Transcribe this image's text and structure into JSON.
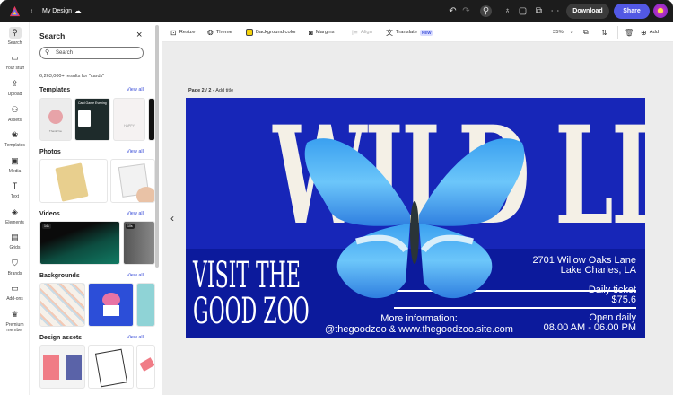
{
  "topbar": {
    "title": "My Design",
    "download": "Download",
    "share": "Share"
  },
  "rail": [
    {
      "label": "Search",
      "icon": "search"
    },
    {
      "label": "Your stuff",
      "icon": "folder"
    },
    {
      "label": "Upload",
      "icon": "upload"
    },
    {
      "label": "Assets",
      "icon": "assets"
    },
    {
      "label": "Templates",
      "icon": "templates"
    },
    {
      "label": "Media",
      "icon": "media"
    },
    {
      "label": "Text",
      "icon": "text"
    },
    {
      "label": "Elements",
      "icon": "elements"
    },
    {
      "label": "Grids",
      "icon": "grids"
    },
    {
      "label": "Brands",
      "icon": "brands"
    },
    {
      "label": "Add-ons",
      "icon": "addons"
    },
    {
      "label": "Premium member",
      "icon": "crown"
    }
  ],
  "panel": {
    "title": "Search",
    "search_placeholder": "Search",
    "results": "6,263,000+ results for \"cards\"",
    "view_all": "View all",
    "sections": [
      "Templates",
      "Photos",
      "Videos",
      "Backgrounds",
      "Design assets"
    ],
    "template_text": [
      "Thank You",
      "Card Game Evening",
      "HAPPY"
    ],
    "video_durations": [
      "14s",
      "10s"
    ]
  },
  "toolbar": {
    "resize": "Resize",
    "theme": "Theme",
    "background_color": "Background color",
    "margins": "Margins",
    "align": "Align",
    "translate": "Translate",
    "new_badge": "NEW",
    "zoom": "35%",
    "add": "Add",
    "bg_swatch": "#f5d20a"
  },
  "canvas": {
    "page_label": "Page 2 / 2 - ",
    "add_title": "Add title"
  },
  "design": {
    "headline": "WILD LIFE",
    "visit": "VISIT THE",
    "good_zoo": "GOOD ZOO",
    "address1": "2701 Willow Oaks Lane",
    "address2": "Lake Charles, LA",
    "ticket_label": "Daily ticket",
    "ticket_price": "$75.6",
    "more_info": "More information:",
    "contact": "@thegoodzoo & www.thegoodzoo.site.com",
    "open_label": "Open daily",
    "hours": "08.00 AM - 06.00 PM",
    "colors": {
      "top": "#1726b8",
      "bottom": "#0c1a9c"
    }
  }
}
